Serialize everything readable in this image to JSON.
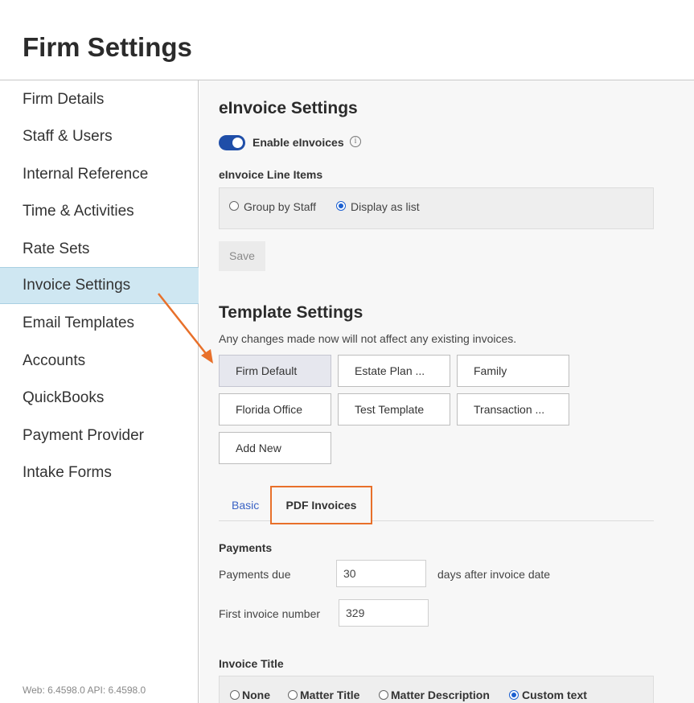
{
  "page": {
    "title": "Firm Settings"
  },
  "sidebar": {
    "items": [
      {
        "label": "Firm Details"
      },
      {
        "label": "Staff & Users"
      },
      {
        "label": "Internal Reference"
      },
      {
        "label": "Time & Activities"
      },
      {
        "label": "Rate Sets"
      },
      {
        "label": "Invoice Settings",
        "active": true
      },
      {
        "label": "Email Templates"
      },
      {
        "label": "Accounts"
      },
      {
        "label": "QuickBooks"
      },
      {
        "label": "Payment Provider"
      },
      {
        "label": "Intake Forms"
      }
    ],
    "version": "Web: 6.4598.0 API: 6.4598.0"
  },
  "einvoice": {
    "heading": "eInvoice Settings",
    "enable_label": "Enable eInvoices",
    "enabled": true,
    "line_items_label": "eInvoice Line Items",
    "options": [
      "Group by Staff",
      "Display as list"
    ],
    "selected_option": "Display as list",
    "save_label": "Save"
  },
  "template": {
    "heading": "Template Settings",
    "note": "Any changes made now will not affect any existing invoices.",
    "templates": [
      "Firm Default",
      "Estate Plan ...",
      "Family",
      "Florida Office",
      "Test Template",
      "Transaction ...",
      "Add New"
    ],
    "selected": "Firm Default"
  },
  "tabs": {
    "basic": "Basic",
    "pdf": "PDF Invoices",
    "active": "PDF Invoices"
  },
  "payments": {
    "heading": "Payments",
    "due_label": "Payments due",
    "due_value": "30",
    "due_suffix": "days after invoice date",
    "first_number_label": "First invoice number",
    "first_number_value": "329"
  },
  "invoice_title": {
    "heading": "Invoice Title",
    "options": [
      "None",
      "Matter Title",
      "Matter Description",
      "Custom text"
    ],
    "selected": "Custom text"
  },
  "colors": {
    "accent": "#1f4ea8",
    "highlight": "#e8702a",
    "active_nav": "#cfe7f2"
  },
  "icons": {
    "info": "info-icon",
    "annotation": "arrow-annotation"
  }
}
